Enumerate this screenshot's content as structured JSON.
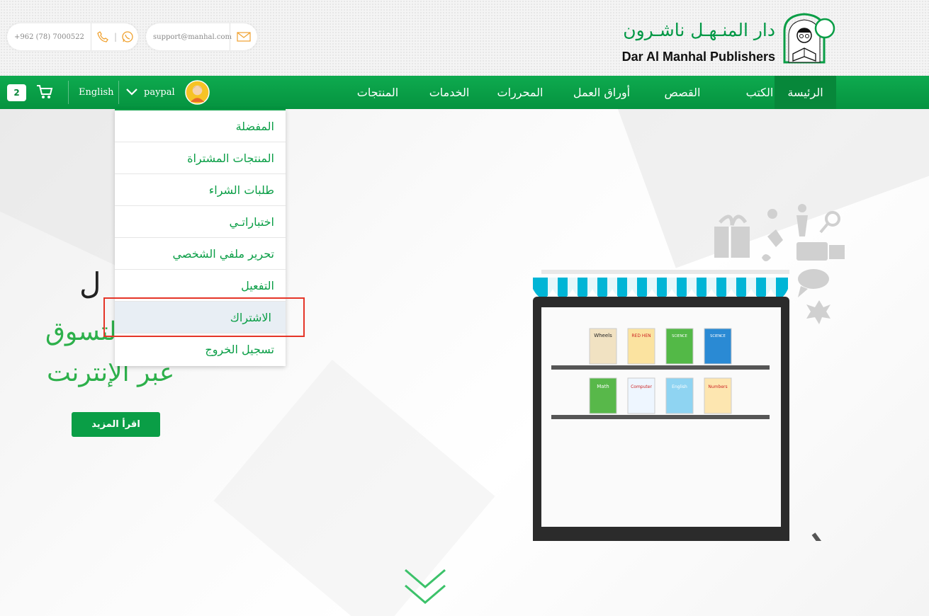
{
  "contact": {
    "phone": "+962 (78) 7000522",
    "email": "support@manhal.com",
    "phone_icon": "phone-icon",
    "whatsapp_icon": "whatsapp-icon",
    "mail_icon": "mail-icon"
  },
  "logo": {
    "arabic": "دار المنـهـل ناشـرون",
    "english": "Dar Al Manhal Publishers"
  },
  "nav": {
    "items": [
      "الرئيسة",
      "الكتب",
      "القصص",
      "أوراق العمل",
      "المحررات",
      "الخدمات",
      "المنتجات"
    ],
    "active_index": 0,
    "cart_count": "2",
    "language": "English",
    "user_name": "paypal"
  },
  "dropdown": {
    "items": [
      "المفضلة",
      "المنتجات المشتراة",
      "طلبات الشراء",
      "اختباراتـي",
      "تحرير ملفي الشخصي",
      "التفعيل",
      "الاشتراك",
      "تسجيل الخروج"
    ],
    "hovered_index": 6
  },
  "hero": {
    "line1": "ل",
    "line2": "التسوق",
    "line3": "عبر الإنترنت",
    "button": "اقرأ المزيد",
    "books_top": [
      "Wheels",
      "Red Hen",
      "Science Thinking",
      "Science Thinking"
    ],
    "books_bottom": [
      "Math Club",
      "Computer Club",
      "English Club",
      "My Numbers"
    ]
  },
  "colors": {
    "brand_green": "#0a9e46",
    "highlight_red": "#e53528"
  }
}
